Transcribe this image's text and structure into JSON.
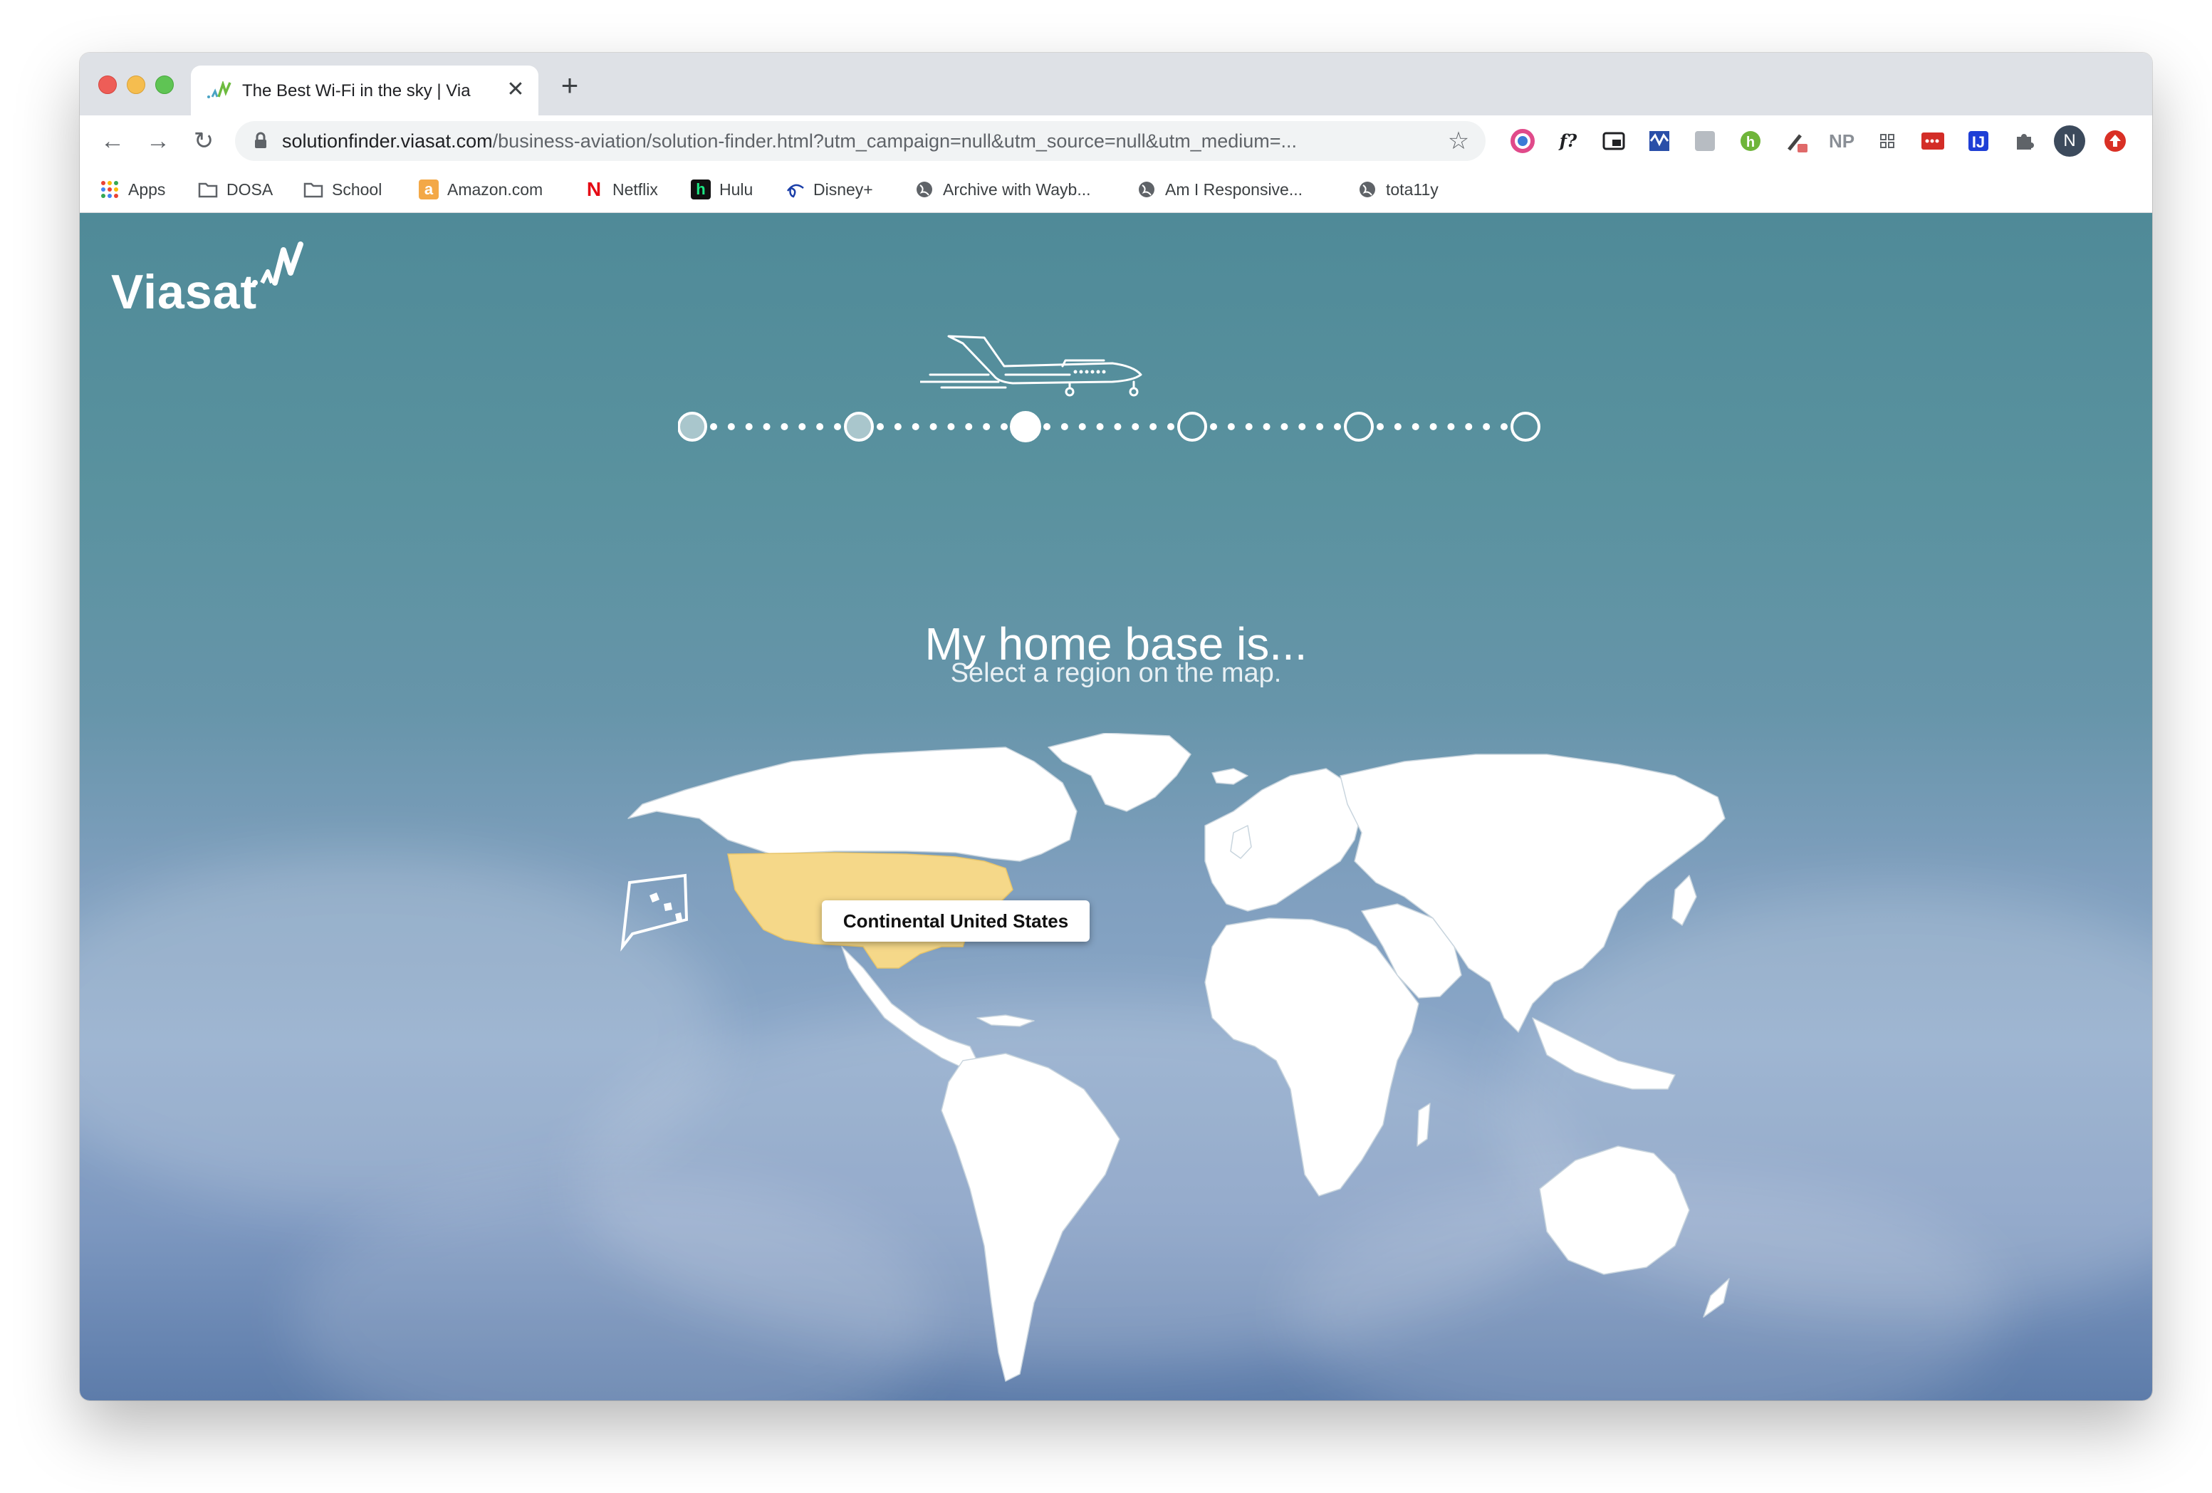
{
  "browser": {
    "tab_title": "The Best Wi-Fi in the sky | Via",
    "tab_close": "✕",
    "new_tab": "+",
    "url_host": "solutionfinder.viasat.com",
    "url_path": "/business-aviation/solution-finder.html?utm_campaign=null&utm_source=null&utm_medium=...",
    "nav": {
      "back": "←",
      "forward": "→",
      "reload": "↻"
    },
    "star": "☆",
    "extensions": [
      "color-picker",
      "font-finder",
      "picture-in-picture",
      "wave",
      "ruler",
      "grammar",
      "eyedropper",
      "newsletter-pro",
      "grid",
      "lastpass",
      "jira",
      "puzzle",
      "profile",
      "update"
    ],
    "extension_labels": {
      "font": "f?",
      "np": "NP",
      "profile": "N"
    }
  },
  "bookmarks": [
    {
      "label": "Apps",
      "icon": "apps-grid"
    },
    {
      "label": "DOSA",
      "icon": "folder"
    },
    {
      "label": "School",
      "icon": "folder"
    },
    {
      "label": "Amazon.com",
      "icon": "amazon",
      "glyph": "a"
    },
    {
      "label": "Netflix",
      "icon": "netflix",
      "glyph": "N"
    },
    {
      "label": "Hulu",
      "icon": "hulu",
      "glyph": "h"
    },
    {
      "label": "Disney+",
      "icon": "disney"
    },
    {
      "label": "Archive with Wayb...",
      "icon": "globe"
    },
    {
      "label": "Am I Responsive...",
      "icon": "globe"
    },
    {
      "label": "tota11y",
      "icon": "globe"
    }
  ],
  "page": {
    "logo": "Viasat",
    "heading": "My home base is...",
    "subheading": "Select a region on the map.",
    "tooltip": "Continental United States",
    "progress": {
      "total_steps": 6,
      "current_step": 3
    },
    "colors": {
      "selected_region": "#f5d889",
      "land": "#ffffff",
      "accent": "#ffffff"
    }
  }
}
